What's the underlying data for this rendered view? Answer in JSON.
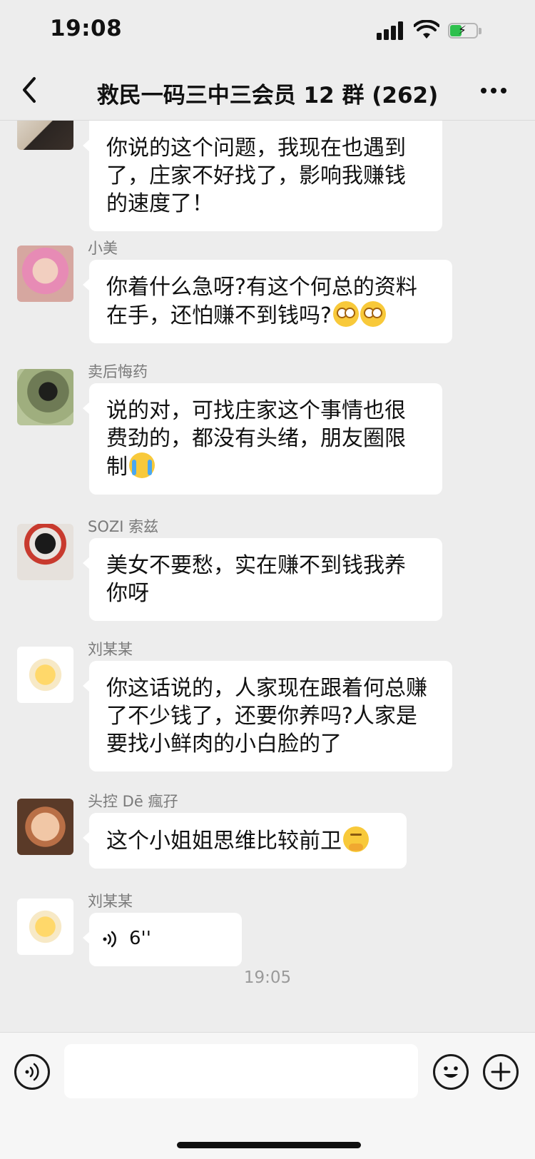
{
  "status_bar": {
    "time": "19:08"
  },
  "nav": {
    "title": "救民一码三中三会员 12 群 (262)"
  },
  "messages": [
    {
      "sender": "",
      "text": "你说的这个问题，我现在也遇到了，庄家不好找了，影响我赚钱的速度了！"
    },
    {
      "sender": "小美",
      "text": "你着什么急呀?有这个何总的资料在手，还怕赚不到钱吗?"
    },
    {
      "sender": "卖后悔药",
      "text": "说的对，可找庄家这个事情也很费劲的，都没有头绪，朋友圈限制"
    },
    {
      "sender": "SOZI 索兹",
      "text": "美女不要愁，实在赚不到钱我养你呀"
    },
    {
      "sender": "刘某某",
      "text": "你这话说的，人家现在跟着何总赚了不少钱了，还要你养吗?人家是要找小鲜肉的小白脸的了"
    },
    {
      "sender": "头控 Dē 瘋孖",
      "text": "这个小姐姐思维比较前卫"
    },
    {
      "sender": "刘某某",
      "voice_duration": "6''"
    }
  ],
  "timestamp": "19:05",
  "input": {
    "placeholder": ""
  }
}
